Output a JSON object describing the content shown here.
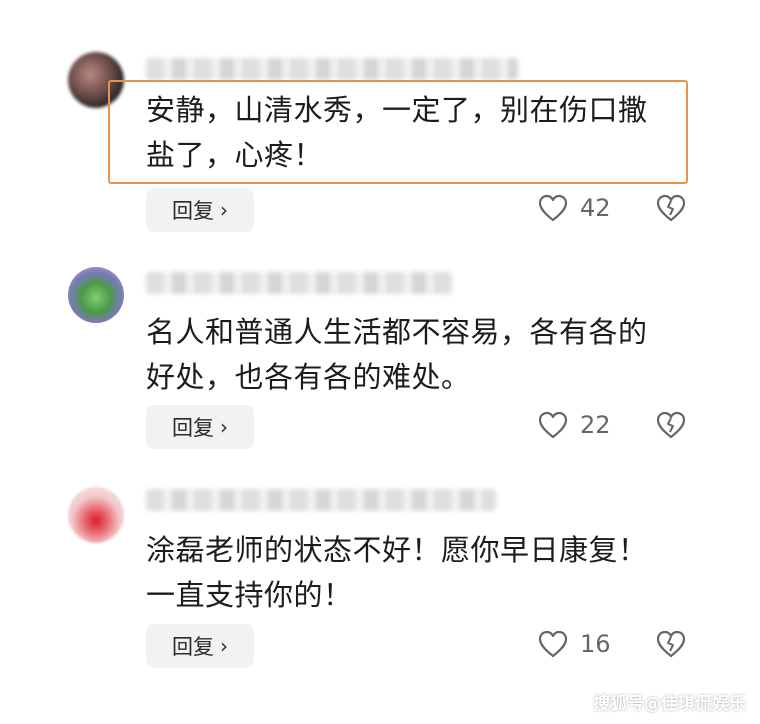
{
  "comments": [
    {
      "text_line1": "安静，山清水秀，一定了，别在伤口撒",
      "text_line2": "盐了，心疼！",
      "reply_label": "回复",
      "like_count": "42"
    },
    {
      "text_line1": "名人和普通人生活都不容易，各有各的",
      "text_line2": "好处，也各有各的难处。",
      "reply_label": "回复",
      "like_count": "22"
    },
    {
      "text_line1": "涂磊老师的状态不好！愿你早日康复！",
      "text_line2": "一直支持你的！",
      "reply_label": "回复",
      "like_count": "16"
    }
  ],
  "watermark": "搜狐号@佳琪侃娱乐",
  "colors": {
    "highlight_border": "#e8934a",
    "reply_bg": "#f2f2f4",
    "icon_gray": "#666666"
  }
}
